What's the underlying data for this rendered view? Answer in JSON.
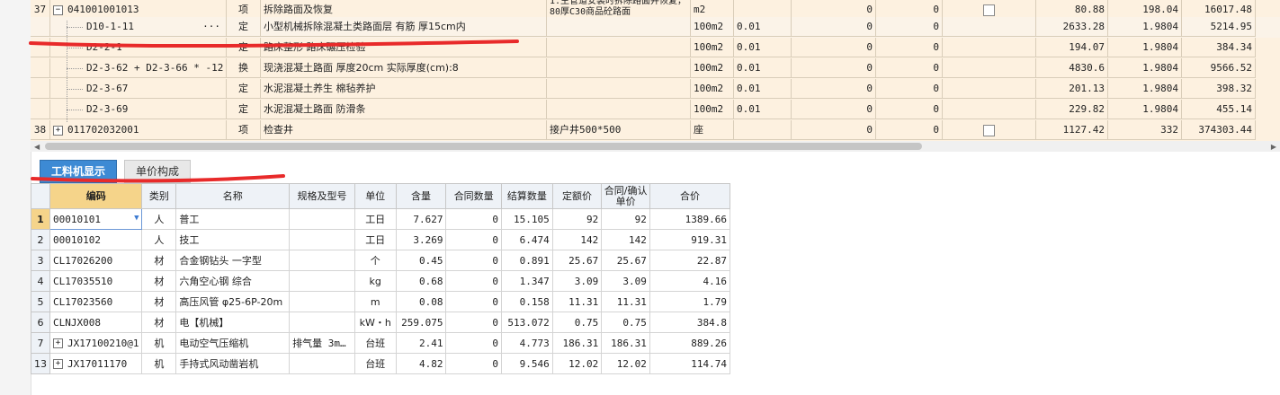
{
  "top_grid": {
    "rows": [
      {
        "no": "37",
        "code": "041001001013",
        "type": "项",
        "name": "拆除路面及恢复",
        "feature": "1.主管道安装时拆除路面并恢复，80厚C30商品砼路面",
        "unit": "m2",
        "qty": "",
        "c1": "0",
        "c2": "0",
        "checkbox": true,
        "price": "80.88",
        "amount": "198.04",
        "total": "16017.48",
        "expand": "−",
        "level": 0
      },
      {
        "no": "",
        "code": "D10-1-11",
        "type": "定",
        "name": "小型机械拆除混凝土类路面层 有筋 厚15cm内",
        "feature": "",
        "unit": "100m2",
        "qty": "0.01",
        "c1": "0",
        "c2": "0",
        "checkbox": false,
        "price": "2633.28",
        "amount": "1.9804",
        "total": "5214.95",
        "expand": "",
        "level": 1,
        "selected": true,
        "ellipsis": "···"
      },
      {
        "no": "",
        "code": "D2-2-1",
        "type": "定",
        "name": "路床整形 路床碾压检验",
        "feature": "",
        "unit": "100m2",
        "qty": "0.01",
        "c1": "0",
        "c2": "0",
        "checkbox": false,
        "price": "194.07",
        "amount": "1.9804",
        "total": "384.34",
        "expand": "",
        "level": 1
      },
      {
        "no": "",
        "code": "D2-3-62 + D2-3-66 * -12",
        "type": "换",
        "name": "现浇混凝土路面 厚度20cm  实际厚度(cm):8",
        "feature": "",
        "unit": "100m2",
        "qty": "0.01",
        "c1": "0",
        "c2": "0",
        "checkbox": false,
        "price": "4830.6",
        "amount": "1.9804",
        "total": "9566.52",
        "expand": "",
        "level": 1
      },
      {
        "no": "",
        "code": "D2-3-67",
        "type": "定",
        "name": "水泥混凝土养生 棉毡养护",
        "feature": "",
        "unit": "100m2",
        "qty": "0.01",
        "c1": "0",
        "c2": "0",
        "checkbox": false,
        "price": "201.13",
        "amount": "1.9804",
        "total": "398.32",
        "expand": "",
        "level": 1
      },
      {
        "no": "",
        "code": "D2-3-69",
        "type": "定",
        "name": "水泥混凝土路面 防滑条",
        "feature": "",
        "unit": "100m2",
        "qty": "0.01",
        "c1": "0",
        "c2": "0",
        "checkbox": false,
        "price": "229.82",
        "amount": "1.9804",
        "total": "455.14",
        "expand": "",
        "level": 1
      },
      {
        "no": "38",
        "code": "011702032001",
        "type": "项",
        "name": "检查井",
        "feature": "接户井500*500",
        "unit": "座",
        "qty": "",
        "c1": "0",
        "c2": "0",
        "checkbox": true,
        "price": "1127.42",
        "amount": "332",
        "total": "374303.44",
        "expand": "+",
        "level": 0
      }
    ]
  },
  "tabs": [
    {
      "label": "工料机显示",
      "active": true
    },
    {
      "label": "单价构成",
      "active": false
    }
  ],
  "bottom_grid": {
    "headers": [
      "编码",
      "类别",
      "名称",
      "规格及型号",
      "单位",
      "含量",
      "合同数量",
      "结算数量",
      "定额价",
      "合同/确认单价",
      "合价"
    ],
    "rows": [
      {
        "rn": "1",
        "code": "00010101",
        "cat": "人",
        "name": "普工",
        "spec": "",
        "unit": "工日",
        "content": "7.627",
        "contract_qty": "0",
        "settle_qty": "15.105",
        "quota_price": "92",
        "contract_price": "92",
        "total": "1389.66",
        "selected": true,
        "expand": ""
      },
      {
        "rn": "2",
        "code": "00010102",
        "cat": "人",
        "name": "技工",
        "spec": "",
        "unit": "工日",
        "content": "3.269",
        "contract_qty": "0",
        "settle_qty": "6.474",
        "quota_price": "142",
        "contract_price": "142",
        "total": "919.31",
        "expand": ""
      },
      {
        "rn": "3",
        "code": "CL17026200",
        "cat": "材",
        "name": "合金钢钻头 一字型",
        "spec": "",
        "unit": "个",
        "content": "0.45",
        "contract_qty": "0",
        "settle_qty": "0.891",
        "quota_price": "25.67",
        "contract_price": "25.67",
        "total": "22.87",
        "expand": ""
      },
      {
        "rn": "4",
        "code": "CL17035510",
        "cat": "材",
        "name": "六角空心钢 综合",
        "spec": "",
        "unit": "kg",
        "content": "0.68",
        "contract_qty": "0",
        "settle_qty": "1.347",
        "quota_price": "3.09",
        "contract_price": "3.09",
        "total": "4.16",
        "expand": ""
      },
      {
        "rn": "5",
        "code": "CL17023560",
        "cat": "材",
        "name": "高压风管 φ25-6P-20m",
        "spec": "",
        "unit": "m",
        "content": "0.08",
        "contract_qty": "0",
        "settle_qty": "0.158",
        "quota_price": "11.31",
        "contract_price": "11.31",
        "total": "1.79",
        "expand": ""
      },
      {
        "rn": "6",
        "code": "CLNJX008",
        "cat": "材",
        "name": "电【机械】",
        "spec": "",
        "unit": "kW・h",
        "content": "259.075",
        "contract_qty": "0",
        "settle_qty": "513.072",
        "quota_price": "0.75",
        "contract_price": "0.75",
        "total": "384.8",
        "expand": ""
      },
      {
        "rn": "7",
        "code": "JX17100210@1",
        "cat": "机",
        "name": "电动空气压缩机",
        "spec": "排气量 3m…",
        "unit": "台班",
        "content": "2.41",
        "contract_qty": "0",
        "settle_qty": "4.773",
        "quota_price": "186.31",
        "contract_price": "186.31",
        "total": "889.26",
        "expand": "+"
      },
      {
        "rn": "13",
        "code": "JX17011170",
        "cat": "机",
        "name": "手持式风动凿岩机",
        "spec": "",
        "unit": "台班",
        "content": "4.82",
        "contract_qty": "0",
        "settle_qty": "9.546",
        "quota_price": "12.02",
        "contract_price": "12.02",
        "total": "114.74",
        "expand": "+"
      }
    ]
  },
  "colors": {
    "tab_active": "#3d8ad4",
    "row_bg": "#fdf1e0",
    "header_selected": "#f5d48a",
    "marker": "#e82a2a"
  }
}
